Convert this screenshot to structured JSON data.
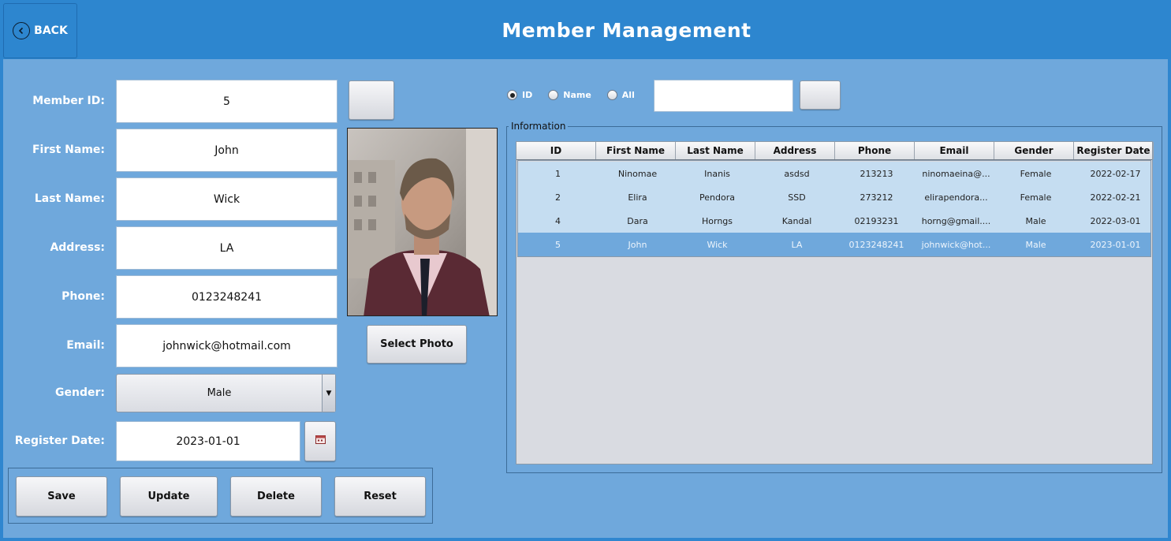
{
  "header": {
    "back_label": "BACK",
    "title": "Member Management"
  },
  "form": {
    "labels": {
      "member_id": "Member ID:",
      "first_name": "First Name:",
      "last_name": "Last Name:",
      "address": "Address:",
      "phone": "Phone:",
      "email": "Email:",
      "gender": "Gender:",
      "register_date": "Register Date:"
    },
    "values": {
      "member_id": "5",
      "first_name": "John",
      "last_name": "Wick",
      "address": "LA",
      "phone": "0123248241",
      "email": "johnwick@hotmail.com",
      "gender": "Male",
      "register_date": "2023-01-01"
    },
    "select_photo_label": "Select Photo"
  },
  "actions": {
    "save": "Save",
    "update": "Update",
    "delete": "Delete",
    "reset": "Reset"
  },
  "search": {
    "options": [
      "ID",
      "Name",
      "All"
    ],
    "selected": "ID",
    "query": ""
  },
  "info": {
    "legend": "Information",
    "columns": [
      "ID",
      "First Name",
      "Last Name",
      "Address",
      "Phone",
      "Email",
      "Gender",
      "Register Date"
    ],
    "rows": [
      [
        "1",
        "Ninomae",
        "Inanis",
        "asdsd",
        "213213",
        "ninomaeina@...",
        "Female",
        "2022-02-17"
      ],
      [
        "2",
        "Elira",
        "Pendora",
        "SSD",
        "273212",
        "elirapendora...",
        "Female",
        "2022-02-21"
      ],
      [
        "4",
        "Dara",
        "Horngs",
        "Kandal",
        "02193231",
        "horng@gmail....",
        "Male",
        "2022-03-01"
      ],
      [
        "5",
        "John",
        "Wick",
        "LA",
        "0123248241",
        "johnwick@hot...",
        "Male",
        "2023-01-01"
      ]
    ],
    "selected_row": 3
  },
  "colors": {
    "titlebar": "#2d86cf",
    "background": "#6fa8dc",
    "row": "#c5ddf1",
    "row_selected": "#6fa8dc"
  }
}
